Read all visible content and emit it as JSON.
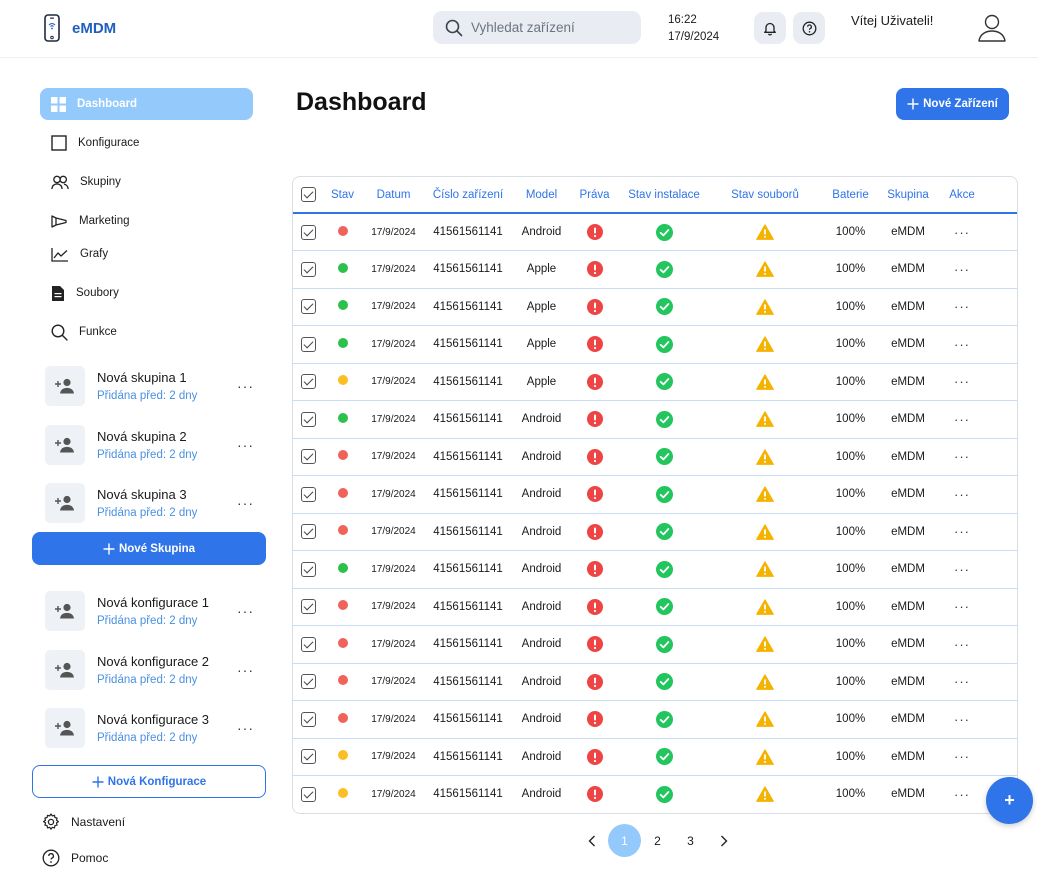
{
  "header": {
    "brand": "eMDM",
    "search_placeholder": "Vyhledat zařízení",
    "time": "16:22",
    "date": "17/9/2024",
    "welcome": "Vítej Uživateli!"
  },
  "sidebar": {
    "nav": [
      {
        "label": "Dashboard",
        "icon": "grid-icon",
        "active": true
      },
      {
        "label": "Konfigurace",
        "icon": "square-icon"
      },
      {
        "label": "Skupiny",
        "icon": "users-icon"
      },
      {
        "label": "Marketing",
        "icon": "megaphone-icon"
      },
      {
        "label": "Grafy",
        "icon": "chart-line-icon"
      },
      {
        "label": "Soubory",
        "icon": "file-icon"
      },
      {
        "label": "Funkce",
        "icon": "search-icon"
      }
    ],
    "groups": [
      {
        "title": "Nová skupina 1",
        "sub": "Přidána před: 2 dny"
      },
      {
        "title": "Nová skupina 2",
        "sub": "Přidána před: 2 dny"
      },
      {
        "title": "Nová skupina 3",
        "sub": "Přidána před: 2 dny"
      }
    ],
    "new_group_label": "Nové Skupina",
    "configs": [
      {
        "title": "Nová konfigurace 1",
        "sub": "Přidána před: 2 dny"
      },
      {
        "title": "Nová konfigurace 2",
        "sub": "Přidána před: 2 dny"
      },
      {
        "title": "Nová konfigurace 3",
        "sub": "Přidána před: 2 dny"
      }
    ],
    "new_config_label": "Nová Konfigurace",
    "settings_label": "Nastavení",
    "help_label": "Pomoc"
  },
  "main": {
    "title": "Dashboard",
    "new_device_label": "Nové Zařízení",
    "columns": [
      "Stav",
      "Datum",
      "Číslo zařízení",
      "Model",
      "Práva",
      "Stav instalace",
      "Stav souborů",
      "Baterie",
      "Skupina",
      "Akce"
    ],
    "rows": [
      {
        "status": "red",
        "date": "17/9/2024",
        "device": "41561561141",
        "model": "Android",
        "battery": "100%",
        "group": "eMDM"
      },
      {
        "status": "green",
        "date": "17/9/2024",
        "device": "41561561141",
        "model": "Apple",
        "battery": "100%",
        "group": "eMDM"
      },
      {
        "status": "green",
        "date": "17/9/2024",
        "device": "41561561141",
        "model": "Apple",
        "battery": "100%",
        "group": "eMDM"
      },
      {
        "status": "green",
        "date": "17/9/2024",
        "device": "41561561141",
        "model": "Apple",
        "battery": "100%",
        "group": "eMDM"
      },
      {
        "status": "yellow",
        "date": "17/9/2024",
        "device": "41561561141",
        "model": "Apple",
        "battery": "100%",
        "group": "eMDM"
      },
      {
        "status": "green",
        "date": "17/9/2024",
        "device": "41561561141",
        "model": "Android",
        "battery": "100%",
        "group": "eMDM"
      },
      {
        "status": "red",
        "date": "17/9/2024",
        "device": "41561561141",
        "model": "Android",
        "battery": "100%",
        "group": "eMDM"
      },
      {
        "status": "red",
        "date": "17/9/2024",
        "device": "41561561141",
        "model": "Android",
        "battery": "100%",
        "group": "eMDM"
      },
      {
        "status": "red",
        "date": "17/9/2024",
        "device": "41561561141",
        "model": "Android",
        "battery": "100%",
        "group": "eMDM"
      },
      {
        "status": "green",
        "date": "17/9/2024",
        "device": "41561561141",
        "model": "Android",
        "battery": "100%",
        "group": "eMDM"
      },
      {
        "status": "red",
        "date": "17/9/2024",
        "device": "41561561141",
        "model": "Android",
        "battery": "100%",
        "group": "eMDM"
      },
      {
        "status": "red",
        "date": "17/9/2024",
        "device": "41561561141",
        "model": "Android",
        "battery": "100%",
        "group": "eMDM"
      },
      {
        "status": "red",
        "date": "17/9/2024",
        "device": "41561561141",
        "model": "Android",
        "battery": "100%",
        "group": "eMDM"
      },
      {
        "status": "red",
        "date": "17/9/2024",
        "device": "41561561141",
        "model": "Android",
        "battery": "100%",
        "group": "eMDM"
      },
      {
        "status": "yellow",
        "date": "17/9/2024",
        "device": "41561561141",
        "model": "Android",
        "battery": "100%",
        "group": "eMDM"
      },
      {
        "status": "yellow",
        "date": "17/9/2024",
        "device": "41561561141",
        "model": "Android",
        "battery": "100%",
        "group": "eMDM"
      }
    ],
    "more_label": "···",
    "pages": [
      "1",
      "2",
      "3"
    ],
    "current_page": "1",
    "fab_label": "+"
  },
  "colors": {
    "accent": "#2f74e8",
    "active_nav": "#93c9fb",
    "status_red": "#f0625a",
    "status_green": "#2cc14b",
    "status_yellow": "#fbbf24",
    "rights_alert": "#ef4444",
    "install_ok": "#22c55e",
    "files_warning": "#f5b301"
  }
}
